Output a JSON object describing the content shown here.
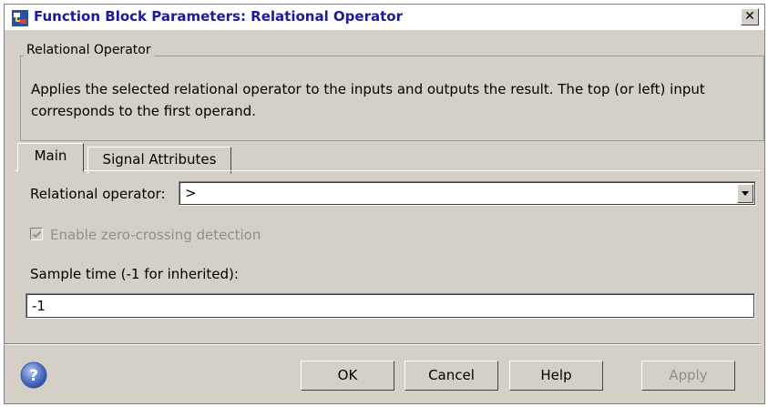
{
  "window": {
    "title": "Function Block Parameters: Relational Operator",
    "close_label": "✕"
  },
  "group": {
    "legend": "Relational Operator",
    "description": "Applies the selected relational operator to the inputs and outputs the result. The top (or left) input corresponds to the first operand."
  },
  "tabs": [
    {
      "label": "Main",
      "selected": true
    },
    {
      "label": "Signal Attributes",
      "selected": false
    }
  ],
  "main": {
    "operator_label": "Relational operator:",
    "operator_value": ">",
    "zero_crossing_label": "Enable zero-crossing detection",
    "zero_crossing_checked": true,
    "zero_crossing_enabled": false,
    "sample_time_label": "Sample time (-1 for inherited):",
    "sample_time_value": "-1"
  },
  "buttons": {
    "ok": "OK",
    "cancel": "Cancel",
    "help": "Help",
    "apply": "Apply"
  },
  "icons": {
    "app": "block-parameters-icon",
    "help": "question-mark-icon",
    "dropdown": "chevron-down-icon"
  },
  "colors": {
    "dialog_bg": "#d4d0c8",
    "title_text": "#1a1a9e",
    "disabled_text": "#8f8f8f"
  }
}
